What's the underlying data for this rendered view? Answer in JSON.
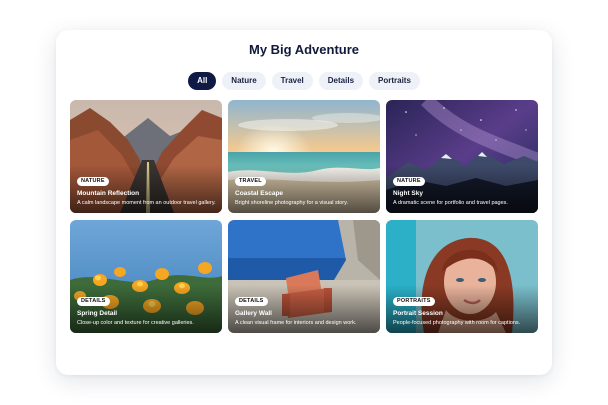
{
  "gallery": {
    "title": "My Big Adventure",
    "filters": [
      {
        "label": "All",
        "active": true
      },
      {
        "label": "Nature",
        "active": false
      },
      {
        "label": "Travel",
        "active": false
      },
      {
        "label": "Details",
        "active": false
      },
      {
        "label": "Portraits",
        "active": false
      }
    ],
    "items": [
      {
        "category": "NATURE",
        "title": "Mountain Reflection",
        "description": "A calm landscape moment from an outdoor travel gallery."
      },
      {
        "category": "TRAVEL",
        "title": "Coastal Escape",
        "description": "Bright shoreline photography for a visual story."
      },
      {
        "category": "NATURE",
        "title": "Night Sky",
        "description": "A dramatic scene for portfolio and travel pages."
      },
      {
        "category": "DETAILS",
        "title": "Spring Detail",
        "description": "Close-up color and texture for creative galleries."
      },
      {
        "category": "DETAILS",
        "title": "Gallery Wall",
        "description": "A clean visual frame for interiors and design work."
      },
      {
        "category": "PORTRAITS",
        "title": "Portrait Session",
        "description": "People-focused photography with room for captions."
      }
    ]
  },
  "colors": {
    "accent": "#0f1a44",
    "tab_bg": "#eef1f8"
  }
}
